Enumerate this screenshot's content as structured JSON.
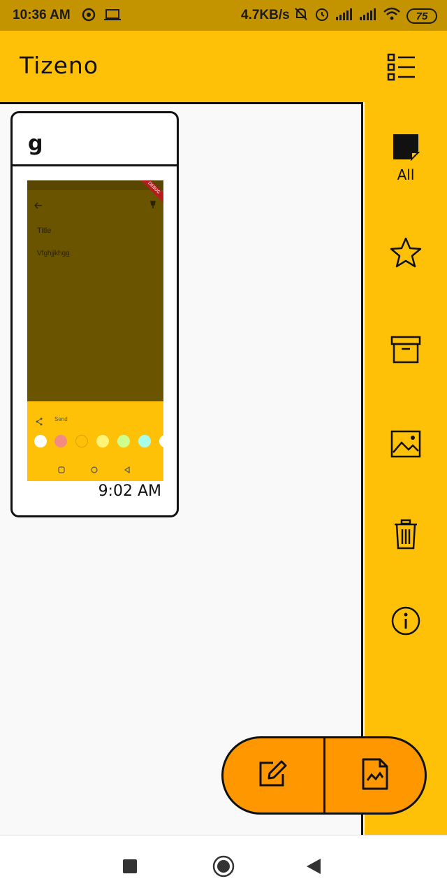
{
  "status_bar": {
    "time": "10:36 AM",
    "network_speed": "4.7KB/s",
    "battery": "75"
  },
  "app_bar": {
    "title": "Tizeno",
    "view_toggle_icon": "list-view-icon"
  },
  "side_rail": {
    "items": [
      {
        "icon": "note-icon",
        "label": "All"
      },
      {
        "icon": "star-icon",
        "label": ""
      },
      {
        "icon": "archive-icon",
        "label": ""
      },
      {
        "icon": "image-icon",
        "label": ""
      },
      {
        "icon": "trash-icon",
        "label": ""
      },
      {
        "icon": "info-icon",
        "label": ""
      }
    ]
  },
  "notes": [
    {
      "title": "g",
      "time": "9:02 AM",
      "thumbnail": {
        "title": "Title",
        "body": "Vfghjjkhgg",
        "send_label": "Send",
        "ribbon": "DEBUG"
      }
    }
  ],
  "fab": {
    "left_icon": "edit-note-icon",
    "right_icon": "image-note-icon"
  },
  "colors": {
    "accent": "#ffc107",
    "fab": "#ff9800",
    "status_bar": "#c49300"
  }
}
